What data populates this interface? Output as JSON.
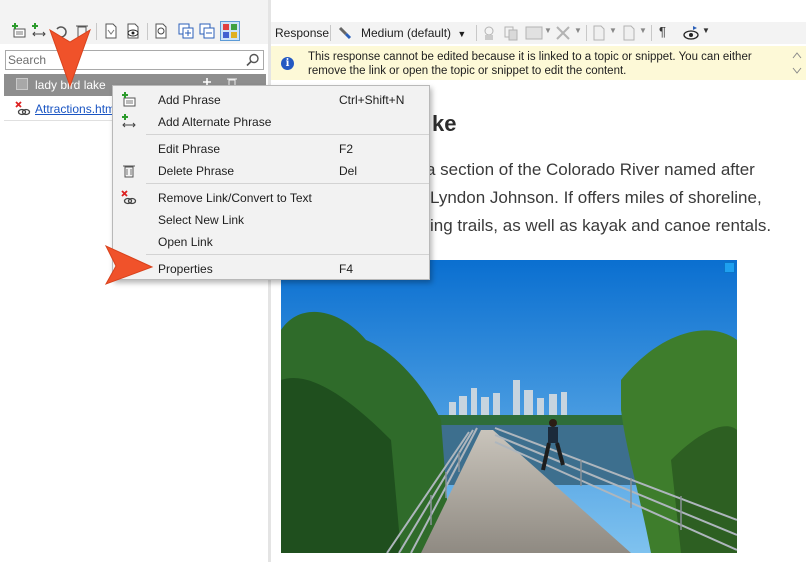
{
  "left_pane": {
    "search": {
      "placeholder": "Search"
    },
    "selected_item": {
      "label": "lady bird lake"
    },
    "link_item": {
      "label": "Attractions.htm"
    }
  },
  "right_pane": {
    "toolbar": {
      "response_label": "Response",
      "style_dropdown": "Medium (default)"
    },
    "info_bar": {
      "message": "This response cannot be edited because it is linked to a topic or snippet. You can either remove the link or open the topic or snippet to edit the content."
    },
    "document": {
      "heading_visible": "ke",
      "lines_visible": [
        "a section of the Colorado River named after",
        "Lyndon Johnson. If offers miles of shoreline,",
        "ing trails, as well as kayak and canoe rentals."
      ]
    }
  },
  "context_menu": {
    "groups": [
      [
        {
          "label": "Add Phrase",
          "shortcut": "Ctrl+Shift+N",
          "icon": "add-phrase-icon"
        },
        {
          "label": "Add Alternate Phrase",
          "shortcut": "",
          "icon": "add-alternate-phrase-icon"
        }
      ],
      [
        {
          "label": "Edit Phrase",
          "shortcut": "F2",
          "icon": ""
        },
        {
          "label": "Delete Phrase",
          "shortcut": "Del",
          "icon": "trash-icon"
        }
      ],
      [
        {
          "label": "Remove Link/Convert to Text",
          "shortcut": "",
          "icon": "remove-link-icon"
        },
        {
          "label": "Select New Link",
          "shortcut": "",
          "icon": ""
        },
        {
          "label": "Open Link",
          "shortcut": "",
          "icon": ""
        }
      ],
      [
        {
          "label": "Properties",
          "shortcut": "F4",
          "icon": ""
        }
      ]
    ]
  },
  "colors": {
    "annotation_arrow": "#f0522a",
    "link": "#1a55c3",
    "selected_row": "#8e8e8e",
    "info_bar": "#fdf9d7",
    "info_icon": "#2459c2"
  }
}
